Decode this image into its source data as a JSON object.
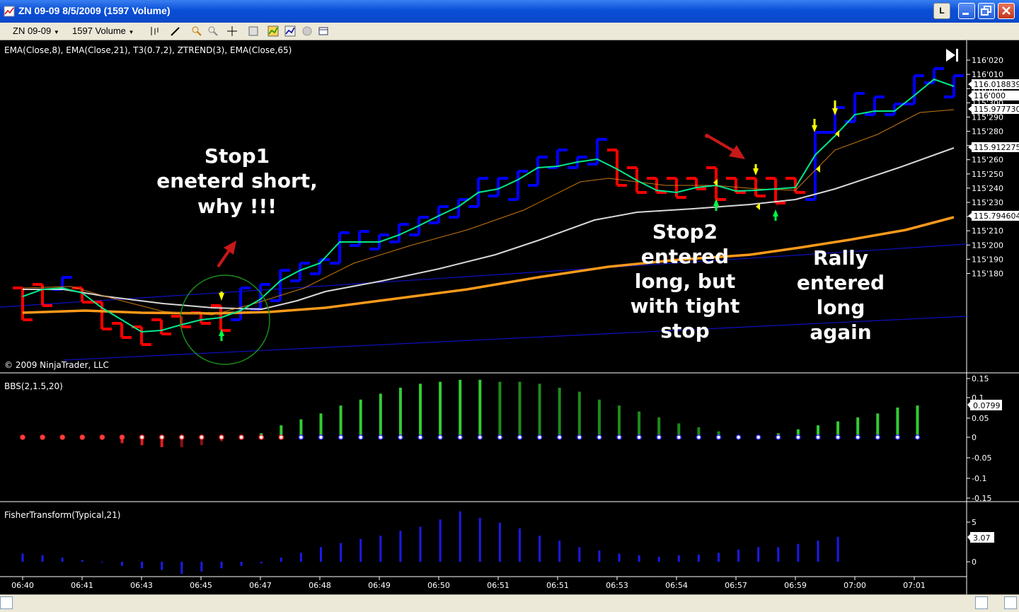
{
  "window": {
    "title": "ZN 09-09  8/5/2009 (1597 Volume)",
    "btn_l": "L"
  },
  "toolbar": {
    "instrument": "ZN 09-09",
    "period": "1597 Volume"
  },
  "price_panel": {
    "indicator_label": "EMA(Close,8),  EMA(Close,21),  T3(0.7,2),  ZTREND(3),  EMA(Close,65)",
    "copyright": "© 2009 NinjaTrader, LLC",
    "axis_ticks": [
      "116'020",
      "116'010",
      "116'000",
      "115'300",
      "115'290",
      "115'280",
      "115'270",
      "115'260",
      "115'250",
      "115'240",
      "115'230",
      "115'220",
      "115'210",
      "115'200",
      "115'190",
      "115'180"
    ],
    "price_markers": [
      "116.018839",
      "116'000",
      "115.977730",
      "115.912275",
      "115.794604"
    ],
    "annotations": [
      {
        "lines": [
          "Stop1",
          "eneterd short,",
          "why !!!"
        ]
      },
      {
        "lines": [
          "Stop2",
          "entered",
          "long, but",
          "with tight",
          "stop"
        ]
      },
      {
        "lines": [
          "Rally",
          "entered",
          "long",
          "again"
        ]
      }
    ]
  },
  "bbs_panel": {
    "label": "BBS(2,1.5,20)",
    "axis_ticks": [
      "0.15",
      "0.1",
      "0.05",
      "0",
      "-0.05",
      "-0.1",
      "-0.15"
    ],
    "marker": "0.0799"
  },
  "fisher_panel": {
    "label": "FisherTransform(Typical,21)",
    "axis_ticks": [
      "5",
      "0"
    ],
    "marker": "3.07"
  },
  "time_axis": [
    "06:40",
    "06:41",
    "06:43",
    "06:45",
    "06:47",
    "06:48",
    "06:49",
    "06:50",
    "06:51",
    "06:51",
    "06:53",
    "06:54",
    "06:57",
    "06:59",
    "07:00",
    "07:01"
  ],
  "colors": {
    "up": "#0000ff",
    "down": "#ff0000",
    "ema8": "#00e88c",
    "ema21": "#c87814",
    "ema65": "#ff9a1a",
    "t3": "#d8d8d8",
    "ztrend": "#1010c0",
    "bbs_up": "#33cc33",
    "bbs_down": "#dd2020"
  },
  "chart_data": [
    {
      "type": "bar",
      "title": "ZN 09-09 8/5/2009 (1597 Volume)",
      "categories": [
        "06:40",
        "06:41",
        "06:43",
        "06:45",
        "06:47",
        "06:48",
        "06:49",
        "06:50",
        "06:51",
        "06:51",
        "06:53",
        "06:54",
        "06:57",
        "06:59",
        "07:00",
        "07:01"
      ],
      "series": [
        {
          "name": "EMA(Close,8)",
          "values": [
            115.209,
            115.213,
            115.192,
            115.199,
            115.225,
            115.249,
            115.264,
            115.282,
            115.284,
            115.271,
            115.266,
            115.266,
            115.295,
            116.005,
            116.018
          ]
        },
        {
          "name": "EMA(Close,65)",
          "values": [
            115.201,
            115.201,
            115.2,
            115.201,
            115.203,
            115.21,
            115.218,
            115.225,
            115.231,
            115.236,
            115.239,
            115.243,
            115.247,
            115.254,
            115.26
          ]
        }
      ]
    },
    {
      "type": "bar",
      "title": "BBS(2,1.5,20)",
      "ylim": [
        -0.15,
        0.15
      ],
      "values": [
        0.003,
        0.002,
        0,
        0,
        -0.005,
        -0.015,
        -0.02,
        -0.025,
        -0.025,
        -0.02,
        -0.01,
        0,
        0.01,
        0.03,
        0.045,
        0.06,
        0.08,
        0.095,
        0.11,
        0.125,
        0.135,
        0.14,
        0.145,
        0.145,
        0.14,
        0.14,
        0.135,
        0.125,
        0.115,
        0.095,
        0.08,
        0.065,
        0.05,
        0.035,
        0.025,
        0.015,
        0.005,
        0.005,
        0.01,
        0.02,
        0.03,
        0.04,
        0.05,
        0.06,
        0.075,
        0.08
      ]
    },
    {
      "type": "bar",
      "title": "FisherTransform(Typical,21)",
      "values": [
        1,
        0.8,
        0.5,
        0.2,
        0,
        -0.5,
        -0.8,
        -1,
        -1.5,
        -1.2,
        -0.8,
        -0.5,
        -0.2,
        0.5,
        1.1,
        1.8,
        2.3,
        2.8,
        3.2,
        3.8,
        4.3,
        5.2,
        6.2,
        5.4,
        4.8,
        4.1,
        3.2,
        2.6,
        1.8,
        1.4,
        1,
        0.8,
        0.6,
        0.8,
        0.9,
        1.1,
        1.5,
        1.8,
        1.8,
        2.2,
        2.6,
        3.07
      ]
    }
  ]
}
